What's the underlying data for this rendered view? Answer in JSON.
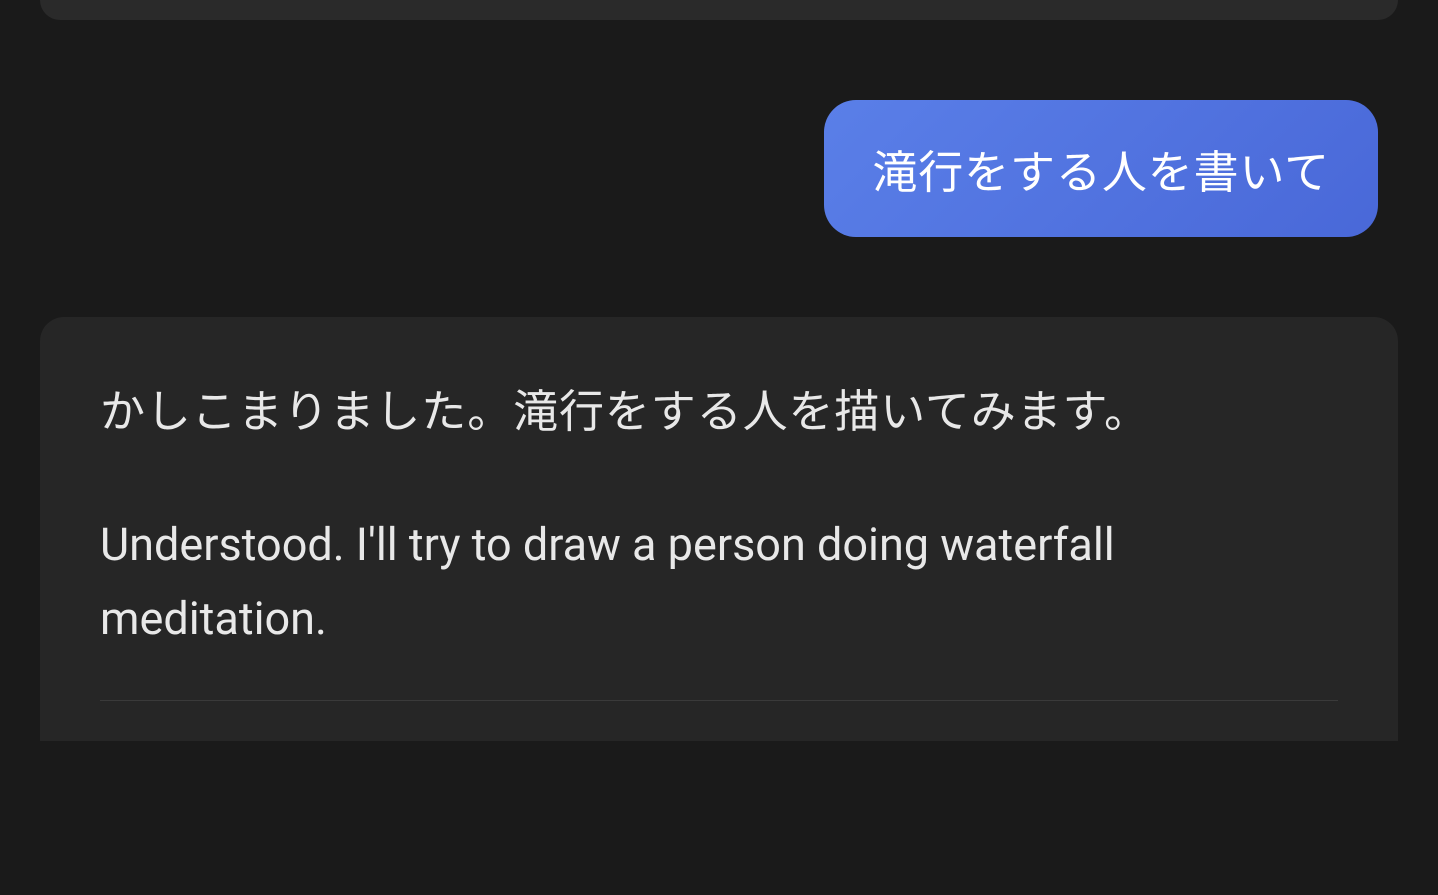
{
  "messages": {
    "user": {
      "text": "滝行をする人を書いて"
    },
    "assistant": {
      "text_jp": "かしこまりました。滝行をする人を描いてみます。",
      "text_en": "Understood. I'll try to draw a person doing waterfall meditation."
    }
  }
}
